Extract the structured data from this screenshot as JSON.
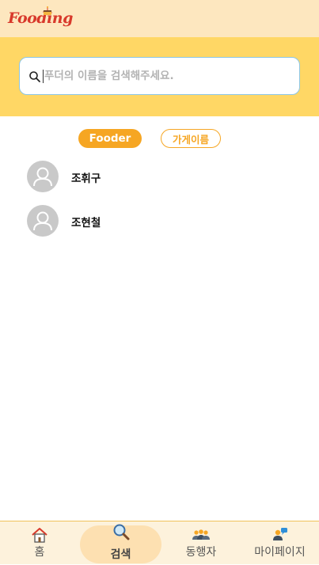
{
  "header": {
    "logo_text": "Fooding"
  },
  "search": {
    "placeholder": "푸더의 이름을 검색해주세요.",
    "value": ""
  },
  "tabs": [
    {
      "label": "Fooder",
      "active": true
    },
    {
      "label": "가게이름",
      "active": false
    }
  ],
  "results": [
    {
      "name": "조휘구",
      "icon": "user-icon"
    },
    {
      "name": "조현철",
      "icon": "user-icon"
    }
  ],
  "bottom_nav": [
    {
      "label": "홈",
      "icon": "home-icon",
      "active": false
    },
    {
      "label": "검색",
      "icon": "search-icon",
      "active": true
    },
    {
      "label": "동행자",
      "icon": "companions-icon",
      "active": false
    },
    {
      "label": "마이페이지",
      "icon": "mypage-icon",
      "active": false
    }
  ],
  "colors": {
    "header_bg": "#fde7bf",
    "search_band_bg": "#ffd765",
    "accent": "#f6a623",
    "logo": "#d8392b",
    "nav_bg": "#fdf2dc"
  }
}
